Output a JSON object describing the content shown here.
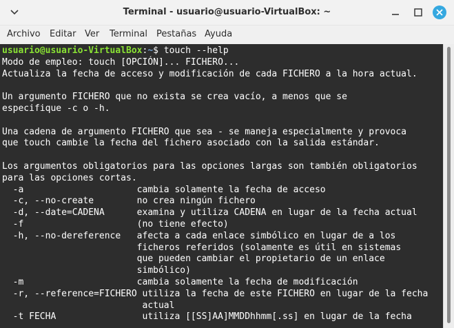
{
  "window": {
    "title": "Terminal - usuario@usuario-VirtualBox: ~",
    "icons": {
      "menu": "chevron-down-icon",
      "minimize": "minimize-icon",
      "maximize": "maximize-icon",
      "close": "close-icon"
    },
    "colors": {
      "close_button": "#35a8e0",
      "terminal_bg": "#2d2d2d",
      "prompt_user": "#8ae234",
      "prompt_path": "#729fcf"
    }
  },
  "menubar": {
    "items": [
      "Archivo",
      "Editar",
      "Ver",
      "Terminal",
      "Pestañas",
      "Ayuda"
    ]
  },
  "terminal": {
    "prompt": {
      "user_host": "usuario@usuario-VirtualBox",
      "separator": ":",
      "path": "~",
      "symbol": "$",
      "command": " touch --help"
    },
    "output": "Modo de empleo: touch [OPCIÓN]... FICHERO...\nActualiza la fecha de acceso y modificación de cada FICHERO a la hora actual.\n\nUn argumento FICHERO que no exista se crea vacío, a menos que se\nespecifique -c o -h.\n\nUna cadena de argumento FICHERO que sea - se maneja especialmente y provoca\nque touch cambie la fecha del fichero asociado con la salida estándar.\n\nLos argumentos obligatorios para las opciones largas son también obligatorios\npara las opciones cortas.\n  -a                     cambia solamente la fecha de acceso\n  -c, --no-create        no crea ningún fichero\n  -d, --date=CADENA      examina y utiliza CADENA en lugar de la fecha actual\n  -f                     (no tiene efecto)\n  -h, --no-dereference   afecta a cada enlace simbólico en lugar de a los\n                         ficheros referidos (solamente es útil en sistemas\n                         que pueden cambiar el propietario de un enlace\n                         simbólico)\n  -m                     cambia solamente la fecha de modificación\n  -r, --reference=FICHERO utiliza la fecha de este FICHERO en lugar de la fecha\n                          actual\n  -t FECHA                utiliza [[SS]AA]MMDDhhmm[.ss] en lugar de la fecha"
  }
}
